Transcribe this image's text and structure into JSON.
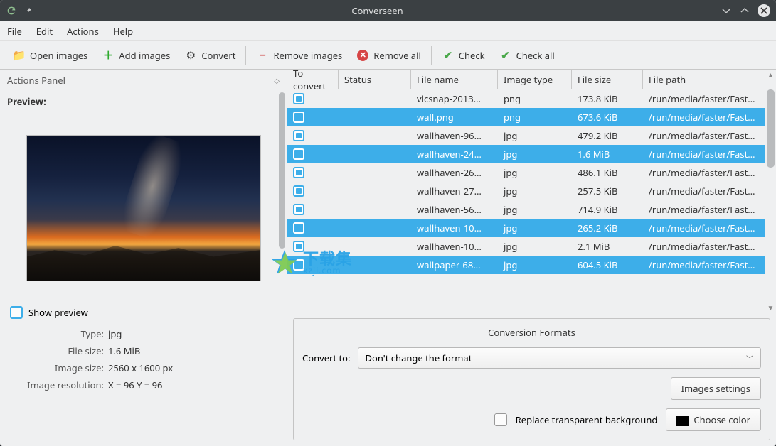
{
  "window": {
    "title": "Converseen"
  },
  "menu": {
    "file": "File",
    "edit": "Edit",
    "actions": "Actions",
    "help": "Help"
  },
  "toolbar": {
    "open": "Open images",
    "add": "Add images",
    "convert": "Convert",
    "remove": "Remove images",
    "remove_all": "Remove all",
    "check": "Check",
    "check_all": "Check all"
  },
  "panel": {
    "title": "Actions Panel",
    "preview_label": "Preview:",
    "show_preview": "Show preview",
    "info": {
      "type_label": "Type:",
      "type": "jpg",
      "size_label": "File size:",
      "size": "1.6 MiB",
      "dim_label": "Image size:",
      "dim": "2560 x 1600 px",
      "res_label": "Image resolution:",
      "res": "X = 96 Y = 96"
    }
  },
  "table": {
    "headers": {
      "to_convert": "To convert",
      "status": "Status",
      "file_name": "File name",
      "image_type": "Image type",
      "file_size": "File size",
      "file_path": "File path"
    },
    "rows": [
      {
        "checked": true,
        "sel": false,
        "name": "vlcsnap-2013…",
        "type": "png",
        "size": "173.8 KiB",
        "path": "/run/media/faster/Fast…"
      },
      {
        "checked": false,
        "sel": true,
        "name": "wall.png",
        "type": "png",
        "size": "673.6 KiB",
        "path": "/run/media/faster/Fast…"
      },
      {
        "checked": true,
        "sel": false,
        "name": "wallhaven-96…",
        "type": "jpg",
        "size": "479.2 KiB",
        "path": "/run/media/faster/Fast…"
      },
      {
        "checked": false,
        "sel": true,
        "name": "wallhaven-24…",
        "type": "jpg",
        "size": "1.6 MiB",
        "path": "/run/media/faster/Fast…"
      },
      {
        "checked": true,
        "sel": false,
        "name": "wallhaven-26…",
        "type": "jpg",
        "size": "486.1 KiB",
        "path": "/run/media/faster/Fast…"
      },
      {
        "checked": true,
        "sel": false,
        "name": "wallhaven-27…",
        "type": "jpg",
        "size": "257.5 KiB",
        "path": "/run/media/faster/Fast…"
      },
      {
        "checked": true,
        "sel": false,
        "name": "wallhaven-56…",
        "type": "jpg",
        "size": "714.9 KiB",
        "path": "/run/media/faster/Fast…"
      },
      {
        "checked": false,
        "sel": true,
        "name": "wallhaven-10…",
        "type": "jpg",
        "size": "265.2 KiB",
        "path": "/run/media/faster/Fast…"
      },
      {
        "checked": true,
        "sel": false,
        "name": "wallhaven-10…",
        "type": "jpg",
        "size": "2.1 MiB",
        "path": "/run/media/faster/Fast…"
      },
      {
        "checked": false,
        "sel": true,
        "name": "wallpaper-68…",
        "type": "jpg",
        "size": "604.5 KiB",
        "path": "/run/media/faster/Fast…"
      }
    ]
  },
  "formats": {
    "title": "Conversion Formats",
    "convert_to_label": "Convert to:",
    "convert_to_value": "Don't change the format",
    "images_settings": "Images settings",
    "replace_bg": "Replace transparent background",
    "choose_color": "Choose color"
  },
  "watermark": {
    "big": "下载集",
    "small": "xzji.com"
  }
}
